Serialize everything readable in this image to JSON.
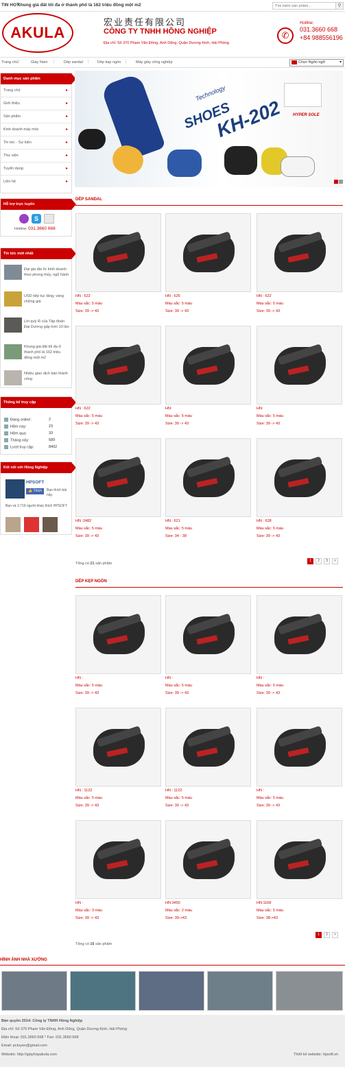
{
  "topbar": {
    "label": "TIN HOT:",
    "headline": "Khung giá đất tối đa ở thành phố là 162 triệu đồng một m2",
    "search_placeholder": "Tìm kiếm sản phẩm..."
  },
  "header": {
    "logo_text": "AKULA",
    "chinese_name": "宏业责任有限公司",
    "company_name": "CÔNG TY TNHH HỒNG NGHIỆP",
    "address": "Địa chỉ: Số 370 Phạm Văn Đồng, Anh Dũng, Quận Dương Kinh, Hải Phòng",
    "hotline_label": "Hotline:",
    "phone1": "031.3660 668",
    "phone2": "+84 988556196"
  },
  "nav": {
    "items": [
      "Trang chủ",
      "Giày Nam",
      "Dép sandal",
      "Dép kẹp ngón",
      "Máy giày công nghiệp"
    ],
    "language": "Chọn Ngôn ngữ"
  },
  "sidebar": {
    "categories_title": "Danh mục sản phẩm",
    "categories": [
      "Trang chủ",
      "Giới thiệu",
      "Sản phẩm",
      "Kinh doanh máy móc",
      "Tin tức - Sự kiện",
      "Thư viện",
      "Tuyển dụng",
      "Liên hệ"
    ],
    "support_title": "Hỗ trợ trực tuyến",
    "support_hotline_label": "Hotline:",
    "support_hotline": "031.3660 668",
    "news_title": "Tin tức mới nhất",
    "news": [
      "Đại gia địa ốc kinh doanh theo phong thủy, ngũ hành",
      "USD tiếp tục tăng, vàng chững giá",
      "Lời quỳ lỗ của Tập đoàn Đại Dương gấp hơn 10 lần",
      "Khung giá đất tối đa ở thành phố là 162 triệu đồng một m2",
      "Nhiều giao dịch bán thành công"
    ],
    "stats_title": "Thống kê truy cập",
    "stats": [
      {
        "label": "Đang online:",
        "value": "2"
      },
      {
        "label": "Hôm nay:",
        "value": "23"
      },
      {
        "label": "Hôm qua:",
        "value": "33"
      },
      {
        "label": "Tháng này:",
        "value": "589"
      },
      {
        "label": "Lượt truy cập:",
        "value": "8402"
      }
    ],
    "fb_title": "Kết nối với Hồng Nghiệp",
    "fb_name": "HPSOFT",
    "fb_like": "Thích",
    "fb_like_note": "Bạn thích bài này.",
    "fb_friends": "Bạn và 3.719 người khác thích HPSOFT."
  },
  "banner": {
    "brand1": "Technology",
    "brand2": "SHOES",
    "model": "KH-202",
    "badge": "HYPER SOLE"
  },
  "sandal": {
    "title": "DÉP SANDAL",
    "products": [
      {
        "code": "HN : 622",
        "color": "Màu sắc: 5 màu",
        "size": "Size: 39 -> 43"
      },
      {
        "code": "HN : 626",
        "color": "Màu sắc: 5 màu",
        "size": "Size: 39 -> 43"
      },
      {
        "code": "HN : 622",
        "color": "Màu sắc: 5 màu",
        "size": "Size: 39 -> 43"
      },
      {
        "code": "HN : 622",
        "color": "Màu sắc: 5 màu",
        "size": "Size: 39 -> 43"
      },
      {
        "code": "HN:",
        "color": "Màu sắc: 5 màu",
        "size": "Size: 39 -> 43"
      },
      {
        "code": "HN:",
        "color": "Màu sắc: 5 màu",
        "size": "Size: 39 -> 43"
      },
      {
        "code": "HN :2482",
        "color": "Màu sắc: 5 màu",
        "size": "Size: 39 -> 43"
      },
      {
        "code": "HN : 621",
        "color": "Màu sắc: 5 màu",
        "size": "Size: 34 - 38"
      },
      {
        "code": "HN : 628",
        "color": "Màu sắc: 5 màu",
        "size": "Size: 39 -> 43"
      }
    ],
    "total_prefix": "Tổng có",
    "total": "21",
    "total_suffix": "sản phẩm",
    "pages": [
      "1",
      "2",
      "3",
      ">"
    ]
  },
  "kep": {
    "title": "DÉP KẸP NGÓN",
    "products": [
      {
        "code": "HN :",
        "color": "Màu sắc: 5 màu",
        "size": "Size: 39 -> 43"
      },
      {
        "code": "HN :",
        "color": "Màu sắc: 5 màu",
        "size": "Size: 39 -> 43"
      },
      {
        "code": "HN :",
        "color": "Màu sắc: 5 màu",
        "size": "Size: 39 -> 43"
      },
      {
        "code": "HN : 1122",
        "color": "Màu sắc: 5 màu",
        "size": "Size: 39 -> 43"
      },
      {
        "code": "HN : 1122",
        "color": "Màu sắc: 5 màu",
        "size": "Size: 39 -> 43"
      },
      {
        "code": "HN :",
        "color": "Màu sắc: 5 màu",
        "size": "Size: 39 -> 43"
      },
      {
        "code": "HN :",
        "color": "Màu sắc: 3 màu",
        "size": "Size: 39 -> 43"
      },
      {
        "code": "HN:3450",
        "color": "Màu sắc: 2 màu",
        "size": "Size: 39->43"
      },
      {
        "code": "HN:1168",
        "color": "Màu sắc: 5 màu",
        "size": "Size: 38->43"
      }
    ],
    "total_prefix": "Tổng có",
    "total": "16",
    "total_suffix": "sản phẩm",
    "pages": [
      "1",
      "2",
      ">"
    ]
  },
  "factory": {
    "title": "HÌNH ẢNH NHÀ XƯỞNG"
  },
  "footer": {
    "copyright": "Bản quyền 2014: Công ty TNHH Hồng Nghiệp",
    "address": "Địa chỉ: Số 370 Phạm Văn Đồng, Anh Dũng, Quận Dương Kinh, Hải Phòng",
    "phone": "Điện thoại: 031.3660 668 * Fax: 031.3660 668",
    "email": "Email: pctuyen@gmail.com",
    "website": "Website: http://giayhopakula.com",
    "credit": "Thiết kế website: hpsoft.vn"
  }
}
